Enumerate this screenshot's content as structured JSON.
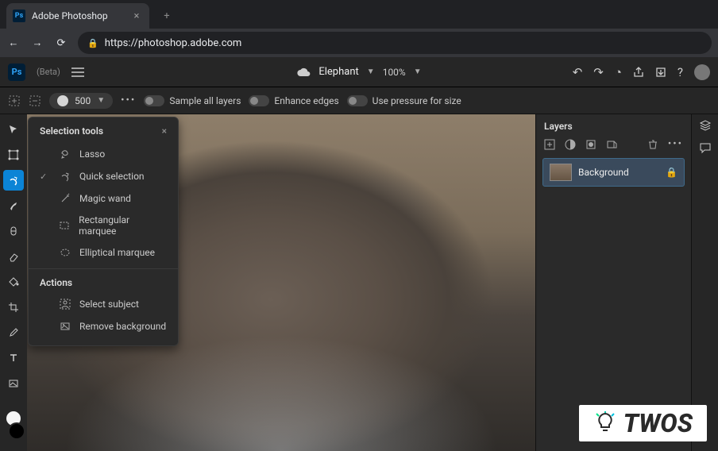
{
  "browser": {
    "tab_title": "Adobe Photoshop",
    "url": "https://photoshop.adobe.com"
  },
  "top_bar": {
    "beta_label": "(Beta)",
    "document_name": "Elephant",
    "zoom": "100%"
  },
  "options_bar": {
    "brush_size": "500",
    "sample_all": "Sample all layers",
    "enhance_edges": "Enhance edges",
    "use_pressure": "Use pressure for size"
  },
  "popup": {
    "section_tools": "Selection tools",
    "items": [
      "Lasso",
      "Quick selection",
      "Magic wand",
      "Rectangular marquee",
      "Elliptical marquee"
    ],
    "selected_index": 1,
    "section_actions": "Actions",
    "actions": [
      "Select subject",
      "Remove background"
    ]
  },
  "layers_panel": {
    "title": "Layers",
    "layer_name": "Background"
  },
  "watermark": "TWOS"
}
